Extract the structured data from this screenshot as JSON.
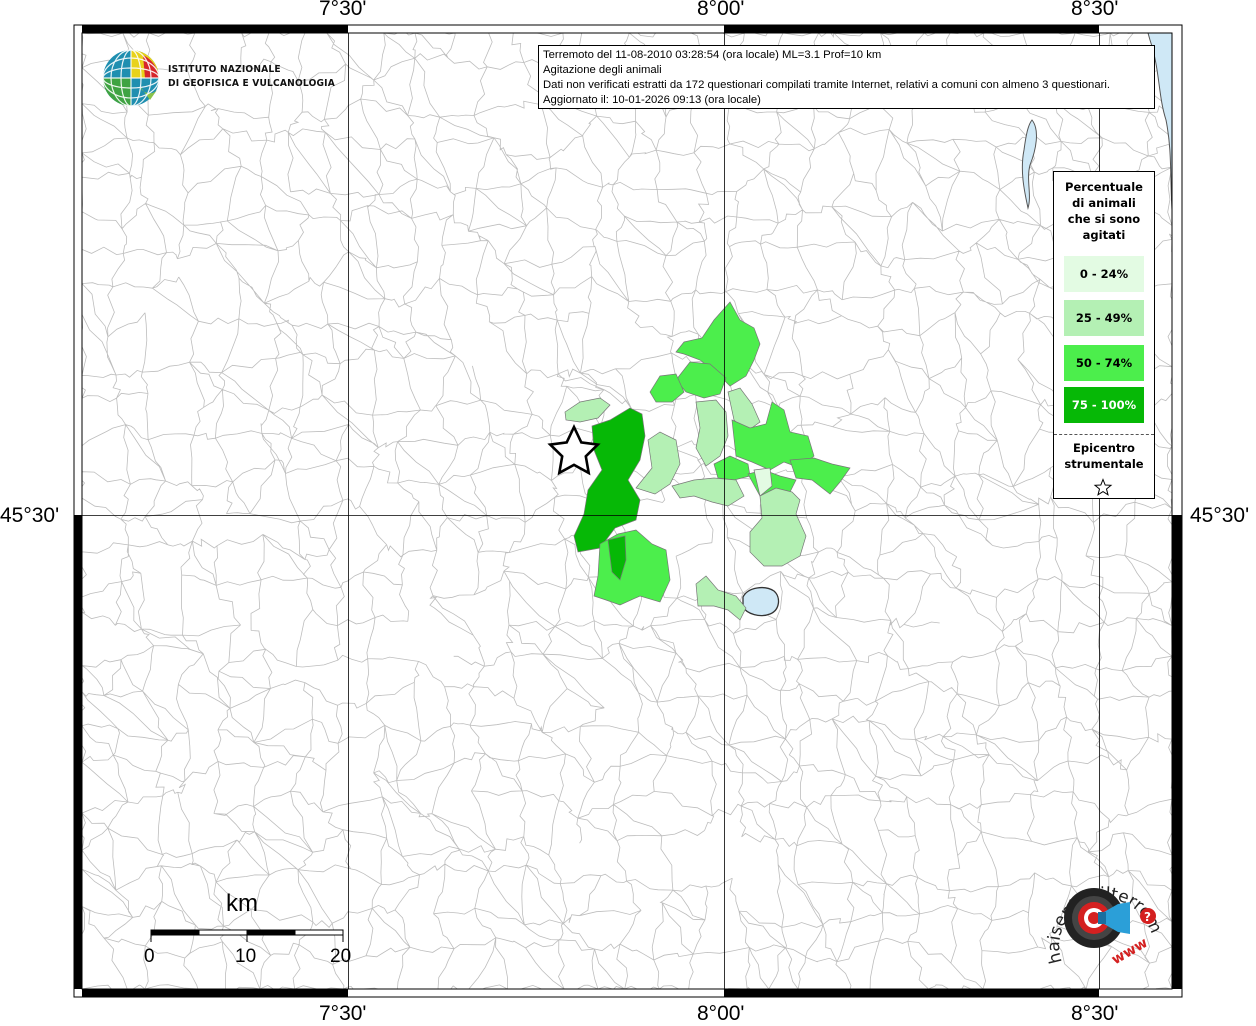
{
  "map": {
    "longitude_ticks": [
      "7°30'",
      "8°00'",
      "8°30'"
    ],
    "latitude_ticks": [
      "45°30'"
    ],
    "colors": {
      "boundary": "#bdbdbd",
      "graticule": "#000000",
      "lake": "#cfe8f6",
      "class_0_24": "#e3fbe3",
      "class_25_49": "#b4f0b4",
      "class_50_74": "#4cee4c",
      "class_75_100": "#06b806"
    }
  },
  "logo": {
    "line1": "ISTITUTO NAZIONALE",
    "line2": "DI GEOFISICA E VULCANOLOGIA"
  },
  "info": {
    "line1": "Terremoto del 11-08-2010 03:28:54 (ora locale) ML=3.1 Prof=10 km",
    "line2": "Agitazione degli animali",
    "line3": "Dati non verificati estratti da 172 questionari compilati tramite Internet, relativi a comuni con almeno 3 questionari.",
    "line4": "Aggiornato il: 10-01-2026 09:13 (ora locale)"
  },
  "legend": {
    "title_lines": [
      "Percentuale",
      "di animali",
      "che si sono",
      "agitati"
    ],
    "classes": [
      {
        "label": "0 - 24%",
        "color": "#e3fbe3",
        "text_color": "#000000"
      },
      {
        "label": "25 - 49%",
        "color": "#b4f0b4",
        "text_color": "#000000"
      },
      {
        "label": "50 - 74%",
        "color": "#4cee4c",
        "text_color": "#000000"
      },
      {
        "label": "75 - 100%",
        "color": "#06b806",
        "text_color": "#ffffff"
      }
    ],
    "epicenter_lines": [
      "Epicentro",
      "strumentale"
    ],
    "epicenter_icon": "star-icon"
  },
  "scale_bar": {
    "unit": "km",
    "ticks": [
      "0",
      "10",
      "20"
    ]
  },
  "hsit_logo": {
    "arc_text": "haisentitoilterremoto.it",
    "www": "www",
    "icon": "speaker-target-icon"
  }
}
